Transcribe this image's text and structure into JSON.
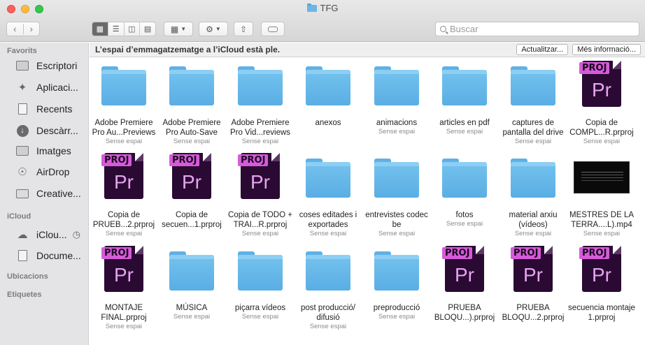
{
  "window": {
    "title": "TFG"
  },
  "toolbar": {
    "search_placeholder": "Buscar"
  },
  "sidebar": {
    "favorites_label": "Favorits",
    "favorites": [
      {
        "label": "Escriptori",
        "icon": "desktop-icon"
      },
      {
        "label": "Aplicaci...",
        "icon": "applications-icon"
      },
      {
        "label": "Recents",
        "icon": "recents-icon"
      },
      {
        "label": "Descàrr...",
        "icon": "downloads-icon"
      },
      {
        "label": "Imatges",
        "icon": "pictures-icon"
      },
      {
        "label": "AirDrop",
        "icon": "airdrop-icon"
      },
      {
        "label": "Creative...",
        "icon": "folder-icon"
      }
    ],
    "icloud_label": "iCloud",
    "icloud": [
      {
        "label": "iClou...",
        "icon": "icloud-icon"
      },
      {
        "label": "Docume...",
        "icon": "documents-icon"
      }
    ],
    "locations_label": "Ubicacions",
    "tags_label": "Etiquetes"
  },
  "banner": {
    "text": "L’espai d’emmagatzematge a l’iCloud està ple.",
    "update_button": "Actualitzar...",
    "more_button": "Més informació..."
  },
  "items": [
    {
      "type": "folder",
      "name": "Adobe Premiere Pro Au...Previews",
      "sub": "Sense espai"
    },
    {
      "type": "folder",
      "name": "Adobe Premiere Pro Auto-Save",
      "sub": "Sense espai"
    },
    {
      "type": "folder",
      "name": "Adobe Premiere Pro Vid...reviews",
      "sub": "Sense espai"
    },
    {
      "type": "folder",
      "name": "anexos",
      "sub": ""
    },
    {
      "type": "folder",
      "name": "animacions",
      "sub": "Sense espai"
    },
    {
      "type": "folder",
      "name": "articles en pdf",
      "sub": "Sense espai"
    },
    {
      "type": "folder",
      "name": "captures de pantalla del drive",
      "sub": "Sense espai"
    },
    {
      "type": "proj",
      "name": "Copia de COMPL...R.prproj",
      "sub": "Sense espai"
    },
    {
      "type": "proj",
      "name": "Copia de PRUEB...2.prproj",
      "sub": "Sense espai"
    },
    {
      "type": "proj",
      "name": "Copia de secuen...1.prproj",
      "sub": ""
    },
    {
      "type": "proj",
      "name": "Copia de TODO + TRAI...R.prproj",
      "sub": "Sense espai"
    },
    {
      "type": "folder",
      "name": "coses editades i exportades",
      "sub": "Sense espai"
    },
    {
      "type": "folder",
      "name": "entrevistes codec be",
      "sub": "Sense espai"
    },
    {
      "type": "folder",
      "name": "fotos",
      "sub": "Sense espai"
    },
    {
      "type": "folder",
      "name": "material arxiu (vídeos)",
      "sub": "Sense espai"
    },
    {
      "type": "video",
      "name": "MESTRES DE LA TERRA....L).mp4",
      "sub": "Sense espai"
    },
    {
      "type": "proj",
      "name": "MONTAJE FINAL.prproj",
      "sub": "Sense espai"
    },
    {
      "type": "folder",
      "name": "MÚSICA",
      "sub": "Sense espai"
    },
    {
      "type": "folder",
      "name": "piçarra vídeos",
      "sub": "Sense espai"
    },
    {
      "type": "folder",
      "name": "post producció/ difusió",
      "sub": "Sense espai"
    },
    {
      "type": "folder",
      "name": "preproducció",
      "sub": "Sense espai"
    },
    {
      "type": "proj",
      "name": "PRUEBA BLOQU...).prproj",
      "sub": ""
    },
    {
      "type": "proj",
      "name": "PRUEBA BLOQU...2.prproj",
      "sub": ""
    },
    {
      "type": "proj",
      "name": "secuencia montaje 1.prproj",
      "sub": ""
    }
  ],
  "proj_badge": "PROJ",
  "proj_glyph": "Pr"
}
